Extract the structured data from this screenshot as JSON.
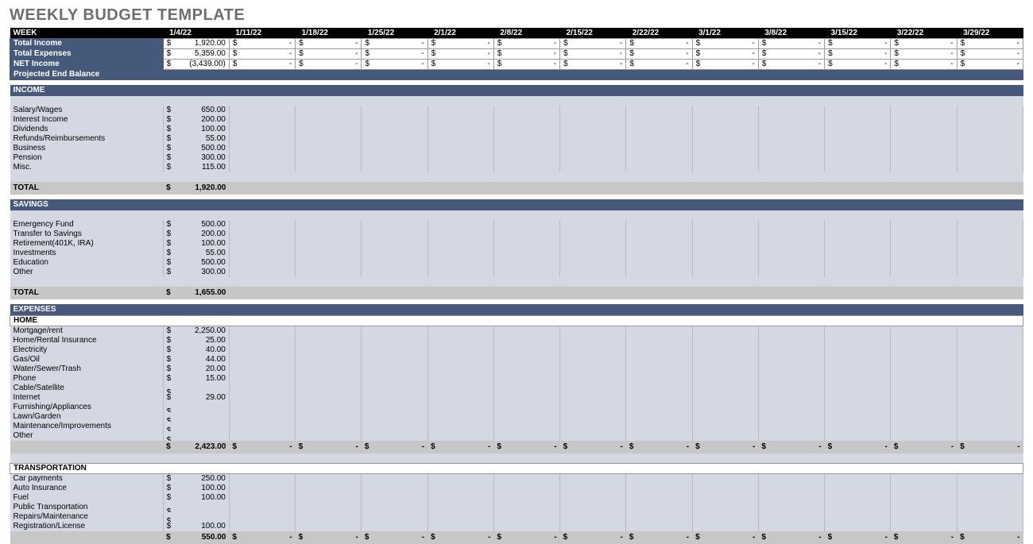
{
  "title": "WEEKLY BUDGET TEMPLATE",
  "weeks": [
    "1/4/22",
    "1/11/22",
    "1/18/22",
    "1/25/22",
    "2/1/22",
    "2/8/22",
    "2/15/22",
    "2/22/22",
    "3/1/22",
    "3/8/22",
    "3/15/22",
    "3/22/22",
    "3/29/22"
  ],
  "week_label": "WEEK",
  "summary": [
    {
      "label": "Total Income",
      "v": "1,920.00"
    },
    {
      "label": "Total Expenses",
      "v": "5,359.00"
    },
    {
      "label": "NET Income",
      "v": "(3,439.00)"
    }
  ],
  "peb_label": "Projected End Balance",
  "sections": [
    {
      "title": "INCOME",
      "rows": [
        {
          "l": "Salary/Wages",
          "v": "650.00"
        },
        {
          "l": "Interest Income",
          "v": "200.00"
        },
        {
          "l": "Dividends",
          "v": "100.00"
        },
        {
          "l": "Refunds/Reimbursements",
          "v": "55.00"
        },
        {
          "l": "Business",
          "v": "500.00"
        },
        {
          "l": "Pension",
          "v": "300.00"
        },
        {
          "l": "Misc.",
          "v": "115.00"
        }
      ],
      "total_label": "TOTAL",
      "total": "1,920.00"
    },
    {
      "title": "SAVINGS",
      "rows": [
        {
          "l": "Emergency Fund",
          "v": "500.00"
        },
        {
          "l": "Transfer to Savings",
          "v": "200.00"
        },
        {
          "l": "Retirement(401K, IRA)",
          "v": "100.00"
        },
        {
          "l": "Investments",
          "v": "55.00"
        },
        {
          "l": "Education",
          "v": "500.00"
        },
        {
          "l": "Other",
          "v": "300.00"
        }
      ],
      "total_label": "TOTAL",
      "total": "1,655.00"
    }
  ],
  "expenses_title": "EXPENSES",
  "expense_groups": [
    {
      "sub": "HOME",
      "rows": [
        {
          "l": "Mortgage/rent",
          "v": "2,250.00"
        },
        {
          "l": "Home/Rental Insurance",
          "v": "25.00"
        },
        {
          "l": "Electricity",
          "v": "40.00"
        },
        {
          "l": "Gas/Oil",
          "v": "44.00"
        },
        {
          "l": "Water/Sewer/Trash",
          "v": "20.00"
        },
        {
          "l": "Phone",
          "v": "15.00"
        },
        {
          "l": "Cable/Satellite",
          "v": ""
        },
        {
          "l": "Internet",
          "v": "29.00"
        },
        {
          "l": "Furnishing/Appliances",
          "v": ""
        },
        {
          "l": "Lawn/Garden",
          "v": ""
        },
        {
          "l": "Maintenance/Improvements",
          "v": ""
        },
        {
          "l": "Other",
          "v": ""
        }
      ],
      "subtotal": "2,423.00"
    },
    {
      "sub": "TRANSPORTATION",
      "rows": [
        {
          "l": "Car payments",
          "v": "250.00"
        },
        {
          "l": "Auto Insurance",
          "v": "100.00"
        },
        {
          "l": "Fuel",
          "v": "100.00"
        },
        {
          "l": "Public Transportation",
          "v": ""
        },
        {
          "l": "Repairs/Maintenance",
          "v": ""
        },
        {
          "l": "Registration/License",
          "v": "100.00"
        }
      ],
      "subtotal": "550.00"
    }
  ],
  "cur": "$",
  "dash": "-"
}
